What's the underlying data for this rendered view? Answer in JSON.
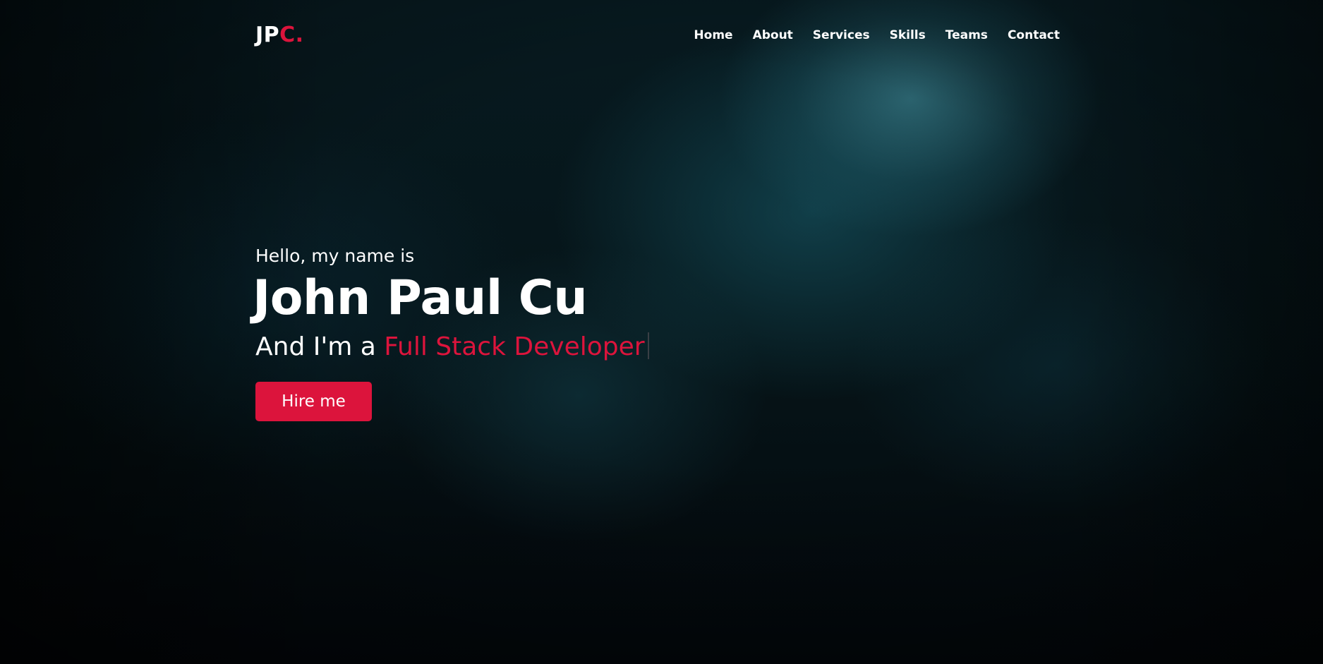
{
  "brand": {
    "logo_main": "JP",
    "logo_accent": "C.",
    "accent_color": "#dc143c"
  },
  "nav": {
    "items": [
      {
        "label": "Home"
      },
      {
        "label": "About"
      },
      {
        "label": "Services"
      },
      {
        "label": "Skills"
      },
      {
        "label": "Teams"
      },
      {
        "label": "Contact"
      }
    ]
  },
  "hero": {
    "greeting": "Hello, my name is",
    "name": "John Paul Cu",
    "role_prefix": "And I'm a ",
    "role_typed": "Full Stack Developer",
    "cta_label": "Hire me"
  }
}
